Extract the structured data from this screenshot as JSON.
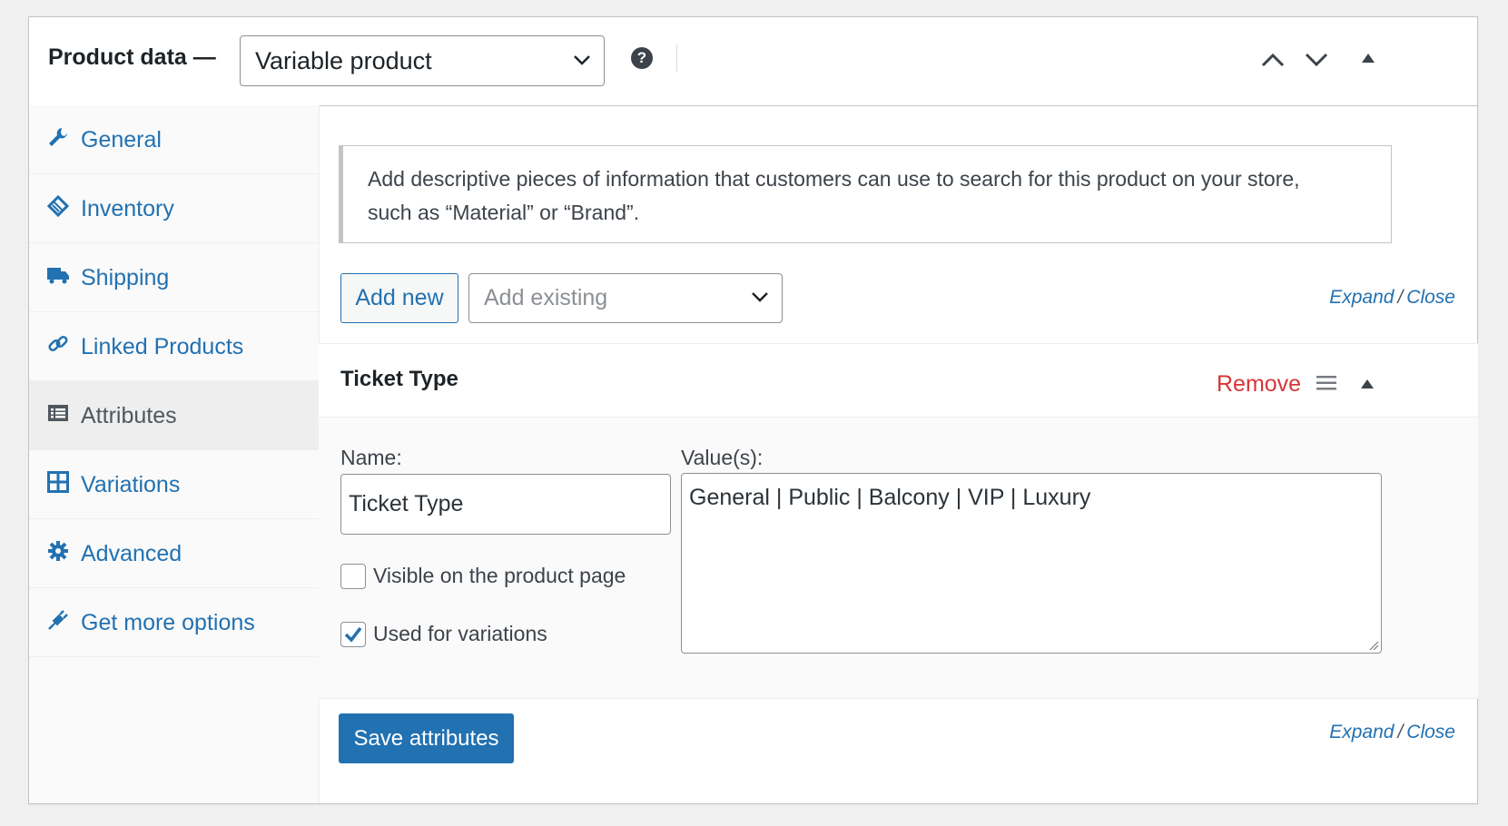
{
  "header": {
    "title": "Product data —",
    "product_type": "Variable product",
    "help_icon": "question-icon",
    "move_up_icon": "chevron-up-icon",
    "move_down_icon": "chevron-down-icon",
    "toggle_icon": "triangle-up-icon"
  },
  "tabs": [
    {
      "label": "General",
      "icon": "wrench-icon"
    },
    {
      "label": "Inventory",
      "icon": "tag-icon"
    },
    {
      "label": "Shipping",
      "icon": "truck-icon"
    },
    {
      "label": "Linked Products",
      "icon": "link-icon"
    },
    {
      "label": "Attributes",
      "icon": "list-icon",
      "active": true
    },
    {
      "label": "Variations",
      "icon": "grid-icon"
    },
    {
      "label": "Advanced",
      "icon": "gear-icon"
    },
    {
      "label": "Get more options",
      "icon": "plugin-icon"
    }
  ],
  "attributes": {
    "notice_line1": "Add descriptive pieces of information that customers can use to search for this product on your store,",
    "notice_line2": "such as “Material” or “Brand”.",
    "add_new_label": "Add new",
    "add_existing_placeholder": "Add existing",
    "expand_label": "Expand",
    "separator": "/",
    "close_label": "Close",
    "attribute": {
      "title": "Ticket Type",
      "remove_label": "Remove",
      "name_label": "Name:",
      "name_value": "Ticket Type",
      "values_label": "Value(s):",
      "values_value": "General | Public | Balcony | VIP | Luxury",
      "visible_label": "Visible on the product page",
      "visible_checked": false,
      "variations_label": "Used for variations",
      "variations_checked": true
    },
    "save_label": "Save attributes"
  },
  "colors": {
    "link": "#2271b1",
    "remove": "#d63638",
    "primary_button": "#2271b1"
  }
}
